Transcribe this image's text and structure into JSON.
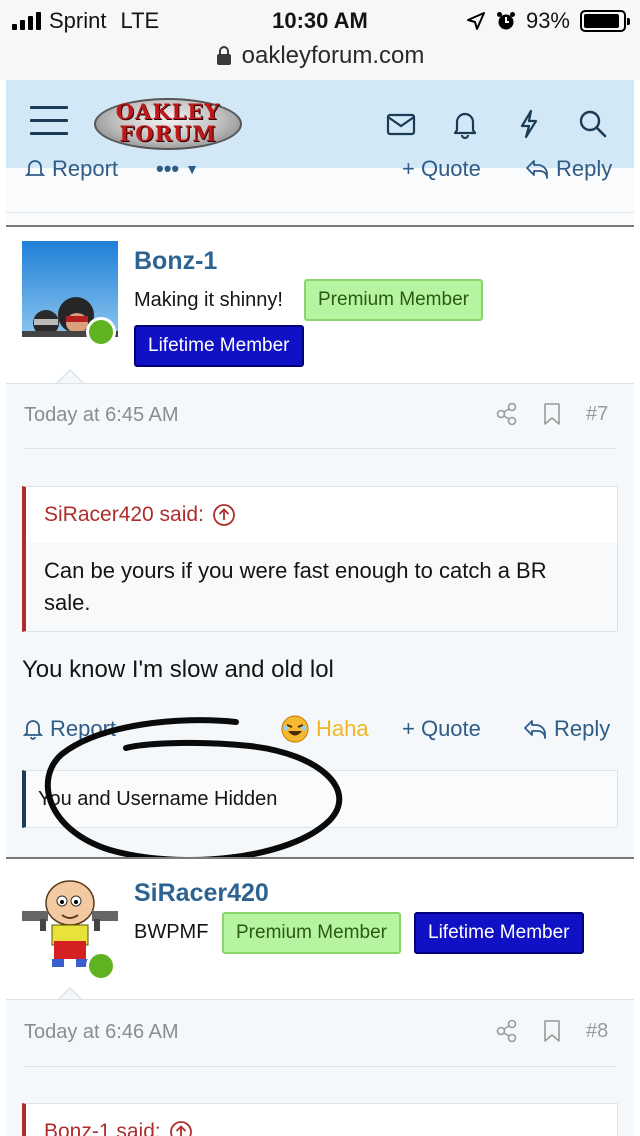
{
  "status_bar": {
    "carrier": "Sprint",
    "network": "LTE",
    "time": "10:30 AM",
    "battery_percent": "93%",
    "battery_level": 0.93
  },
  "browser": {
    "url": "oakleyforum.com"
  },
  "header": {
    "logo_line1": "OAKLEY",
    "logo_line2": "FORUM",
    "icons": [
      "menu-icon",
      "inbox-icon",
      "bell-icon",
      "lightning-icon",
      "search-icon"
    ]
  },
  "prev_actions": {
    "report": "Report",
    "more": "•••",
    "quote": "+ Quote",
    "reply": "Reply"
  },
  "posts": [
    {
      "username": "Bonz-1",
      "user_title": "Making it shinny!",
      "badges": [
        "Premium Member",
        "Lifetime Member"
      ],
      "time": "Today at 6:45 AM",
      "number": "#7",
      "quote_author": "SiRacer420 said:",
      "quote_text": "Can be yours if you were fast enough to catch a BR sale.",
      "message": "You know I'm slow and old lol",
      "actions": {
        "report": "Report",
        "haha": "Haha",
        "quote": "+ Quote",
        "reply": "Reply"
      },
      "reactions": "You and Username Hidden"
    },
    {
      "username": "SiRacer420",
      "user_title": "BWPMF",
      "badges": [
        "Premium Member",
        "Lifetime Member"
      ],
      "time": "Today at 6:46 AM",
      "number": "#8",
      "quote_author": "Bonz-1 said:"
    }
  ],
  "colors": {
    "header_bg": "#d2e8f7",
    "link": "#2f5c87",
    "username": "#2d6391",
    "premium_bg": "#b5f5a2",
    "lifetime_bg": "#1010c4",
    "quote_accent": "#b02d2d",
    "online": "#5fb321"
  }
}
